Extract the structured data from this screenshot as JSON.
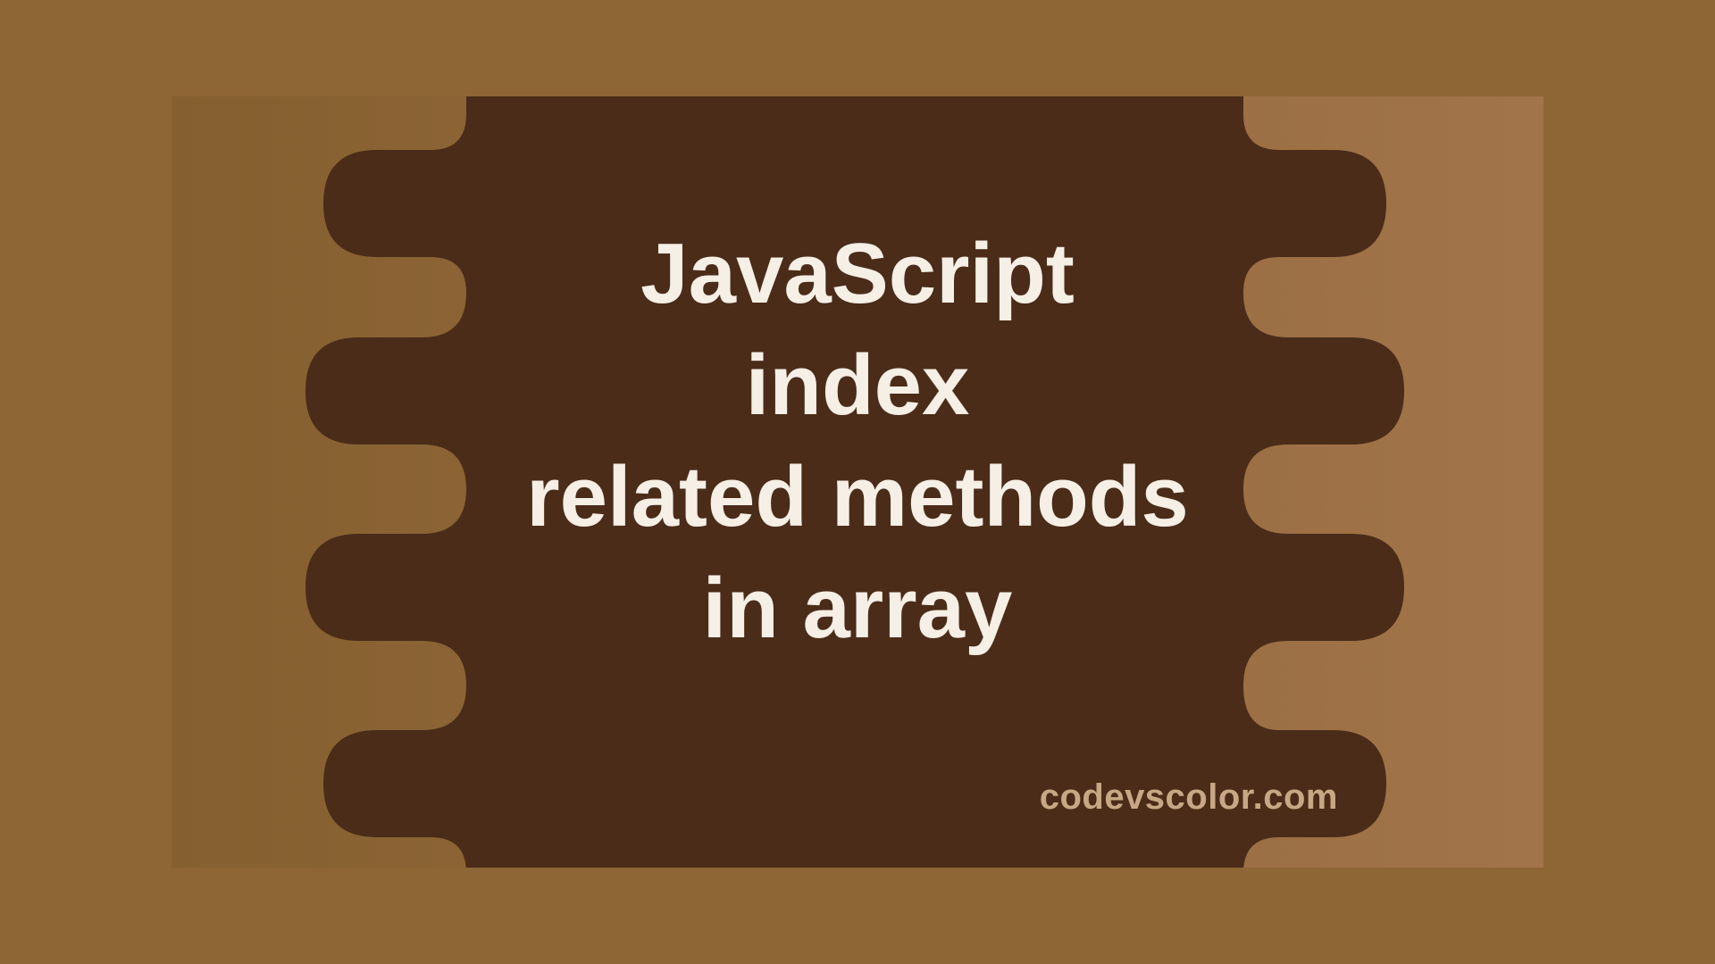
{
  "title_lines": "JavaScript\nindex\nrelated methods\nin array",
  "watermark": "codevscolor.com",
  "colors": {
    "blob": "#4a2c19",
    "bg_left": "#855f2f",
    "bg_right": "#a2744a",
    "text": "#f6efe6",
    "watermark": "#c8a884"
  }
}
